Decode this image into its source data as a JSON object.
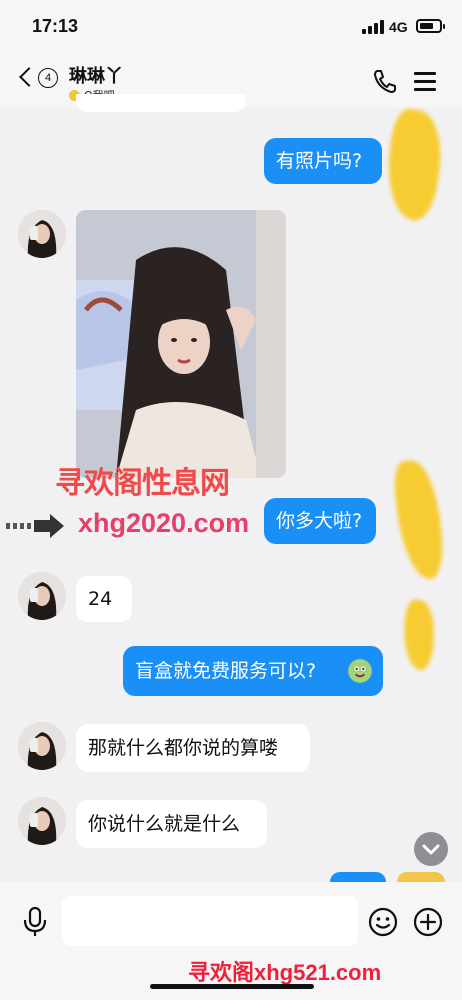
{
  "status": {
    "time": "17:13",
    "network": "4G"
  },
  "header": {
    "unread": "4",
    "name": "琳琳丫",
    "subtitle": "Q我吧"
  },
  "messages": [
    {
      "dir": "out",
      "text": "有照片吗?"
    },
    {
      "dir": "in",
      "type": "photo"
    },
    {
      "dir": "out",
      "text": "你多大啦?"
    },
    {
      "dir": "in",
      "text": "24"
    },
    {
      "dir": "out",
      "text": "盲盒就免费服务可以?"
    },
    {
      "dir": "in",
      "text": "那就什么都你说的算喽"
    },
    {
      "dir": "in",
      "text": "你说什么就是什么"
    }
  ],
  "watermarks": {
    "w1": "寻欢阁性息网",
    "w2": "xhg2020.com",
    "w3": "寻欢阁xhg521.com"
  },
  "colors": {
    "outgoing": "#1a8ff5",
    "incoming": "#ffffff",
    "background": "#f1f1f3"
  },
  "icons": [
    "back-icon",
    "phone-icon",
    "menu-icon",
    "microphone-icon",
    "emoji-icon",
    "plus-icon",
    "chevron-down-icon"
  ]
}
